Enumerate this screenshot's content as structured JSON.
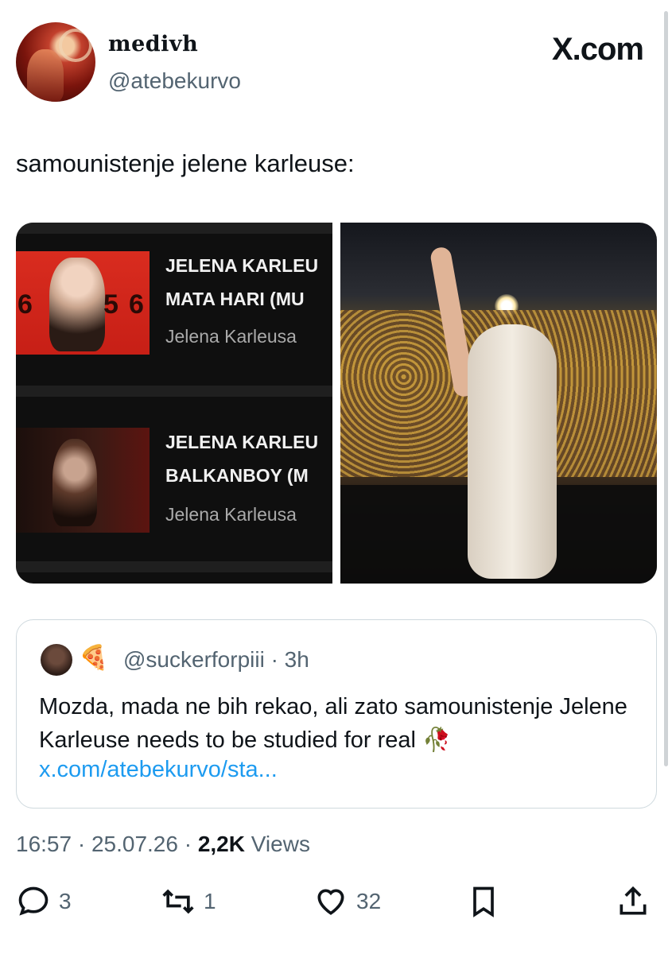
{
  "author": {
    "display_name": "medivh",
    "badge": "",
    "handle": "@atebekurvo"
  },
  "brand": "X.com",
  "tweet_text": "samounistenje jelene karleuse:",
  "media": {
    "left_panel": {
      "videos": [
        {
          "title_line1": "JELENA KARLEU",
          "title_line2": "MATA HARI (MU",
          "channel": "Jelena Karleusa",
          "thumb_numbers": [
            "6",
            "5",
            "6"
          ]
        },
        {
          "title_line1": "JELENA KARLEU",
          "title_line2": "BALKANBOY (M",
          "channel": "Jelena Karleusa"
        }
      ]
    }
  },
  "quote": {
    "emoji": "🍕",
    "handle_time": "@suckerforpiii · 3h",
    "text": "Mozda, mada ne bih rekao, ali zato samounistenje Jelene Karleuse needs to be studied for real 🥀",
    "link": "x.com/atebekurvo/sta..."
  },
  "meta": {
    "time_date": "16:57 · 25.07.26 · ",
    "views_count": "2,2K",
    "views_label": " Views"
  },
  "actions": {
    "replies": "3",
    "reposts": "1",
    "likes": "32"
  },
  "icons": [
    "apple-icon",
    "reply-icon",
    "repost-icon",
    "like-icon",
    "bookmark-icon",
    "share-icon"
  ]
}
